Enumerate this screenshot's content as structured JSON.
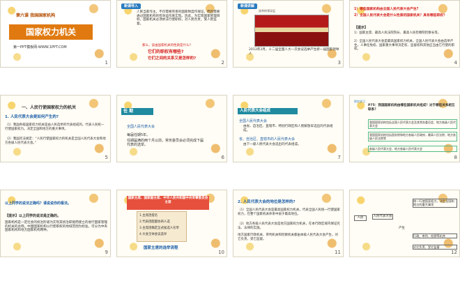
{
  "slides": [
    {
      "num": "1",
      "chapter": "第六课  我国国家机构",
      "title": "国家权力机关",
      "footer": "第一PPT模板网-WWW.1PPT.COM"
    },
    {
      "num": "2",
      "tag": "新课导入",
      "text": "人民当家作主，不仅需要完善的国家制度作保证，而且需要通过国家机构的有效运作来实现。因此，为实现国家管理目标，国家机关必须依法行使职权，对人民负责，受人民监督。",
      "q1": "那么，该由国家机关的性质是什么?",
      "q2": "它们的职权有哪些?",
      "q3": "它们之间的关系又是怎样的?"
    },
    {
      "num": "3",
      "tag": "新课讲解",
      "caption1": "2013年3月，十二届全国人大一次会议选举产生新一届国家领导人",
      "sub": "选举的领导层"
    },
    {
      "num": "4",
      "line1": "1）哪些国家机构由全国人民代表大会产生?",
      "line2": "2）全国人民代表大会是什么性质的国家机关？具有哪些职权？",
      "head": "【提示】",
      "p1": "1）国家主席、最高人民法院院长、最高人民检察院检察长等。",
      "p2": "2）全国人民代表大会是最高国家权力机关，全国人民代表大会由选举产生，人事任免权、国家重大事项决定权、监督权和其他应当由它行使的职权。"
    },
    {
      "num": "5",
      "section": "一、人民行使国家权力的机关",
      "h1": "1. 人民代表大会是如何产生的?",
      "p1": "（1）我国各级国家权力机关是由人民选举的代表组成的。代表人民统一行使国家权力。决定全国和地方的重大事项。",
      "p2": "（2）我国宪法规定：“人民行使国家权力的机关是全国人民代表大会和地方各级人民代表大会。”"
    },
    {
      "num": "6",
      "tag": "任 期",
      "l1": "全国人民代表大会",
      "l2": "每届任期5年。",
      "l3": "任期届满的两个月以前，常务委员会必须完成下届代表的选举。"
    },
    {
      "num": "7",
      "box": "人民代表大会组成",
      "a1": "全国人民代表大会",
      "a2": "由省、自治区、直辖市、特别行政区和人民解放军选出的代表组成。",
      "b1": "省、自治区、直辖市的人民代表大会",
      "b2": "由下一级人民代表大会选出的代表组成。"
    },
    {
      "num": "8",
      "tag": "探究学习",
      "q": "P75：我国国家机构由哪些国家机关组成？对于哪些关系相互联系？",
      "i1": "我国国家机构包括全国人民代表大会及其常务委员会、地方各级人民代表大会",
      "i2": "我国国家机构包括国务院和地方各级人民政府，最高人民法院、地方各级人民法院等",
      "i3": "各级人民代表大会、地方各级人民代表大会"
    },
    {
      "num": "9",
      "q": "以上同学的说法正确吗？请说说你的看法。",
      "head": "【提示】以上同学的说法是正确的。",
      "p": "国家机构是一定社会的统治阶级为实现其统治职能而建立的进行国家管理的机关的总称。中国国家机构以行使职权的地域范围为标准，可分为中央国家机构和地方国家机构两种。"
    },
    {
      "num": "10",
      "banner": "国家主席、国家副主席、中华人民共和国中央军事委员会主席",
      "s1": "1.主席团提名",
      "s2": "2.代表团酝酿协商人选",
      "s3": "3.主席团确定正式候选人名单",
      "s4": "4.大会全体会议选举",
      "caption": "国家主席的选举流程"
    },
    {
      "num": "11",
      "h": "2. 人民代表大会的地位是怎样的?",
      "p1": "（1）全国人民代表大会是最高国家权力机关，代表全国人民统一行使国家权力，在整个国家机关体系中居于最高地位。",
      "p2": "（2）地方各级人民代表大会是地方国家权力机关，在本行政区域内保证宪法、法律的实施。",
      "p3": "地方国家行政机关、审判机关和检察机关都由本级人民代表大会产生，对它负责，受它监督。"
    },
    {
      "num": "12",
      "c1": "人民",
      "c2": "人民代表大会",
      "c3": "统一行使国家权力，决定全国和地方的重大事项",
      "c4": "产生",
      "c5": "行政、审判、检察等机关",
      "c6": "对它负责、受它监督"
    }
  ]
}
